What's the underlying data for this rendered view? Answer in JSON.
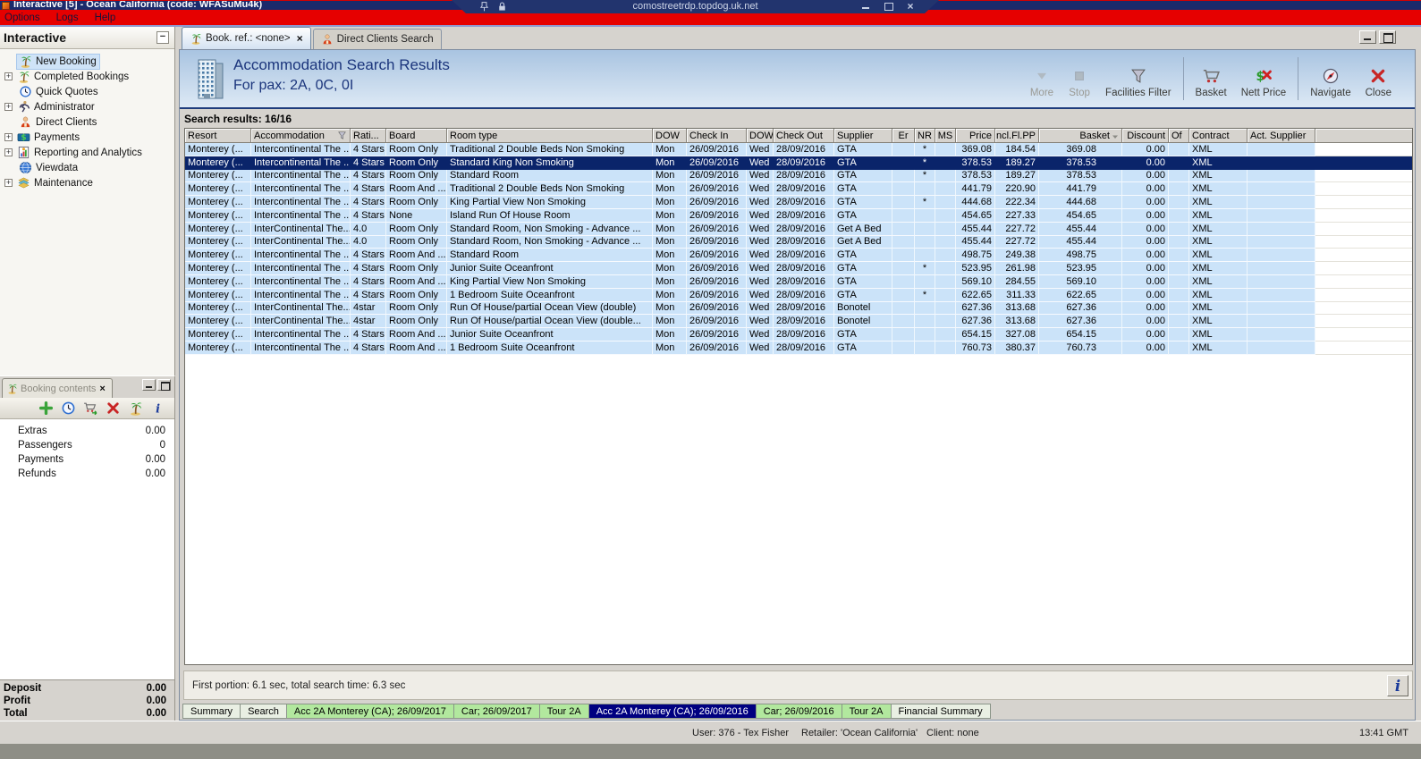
{
  "colors": {
    "accent_navy": "#0a246a",
    "menubar_red": "#e60000",
    "row_blue": "#cbe3f9",
    "tab_green": "#b2e89e",
    "selected_tab_navy": "#000080",
    "header_gradient_top": "#a9c4e1"
  },
  "window": {
    "title": "Interactive [5] - Ocean California (code: WFASuMu4k)",
    "rdp_host": "comostreetrdp.topdog.uk.net"
  },
  "menubar": {
    "items": [
      "Options",
      "Logs",
      "Help"
    ]
  },
  "sidebar": {
    "title": "Interactive",
    "items": [
      {
        "label": "New Booking",
        "icon": "palm-icon",
        "expandable": false,
        "selected": true
      },
      {
        "label": "Completed Bookings",
        "icon": "palm-icon",
        "expandable": true,
        "selected": false
      },
      {
        "label": "Quick Quotes",
        "icon": "clock-icon",
        "expandable": false,
        "selected": false
      },
      {
        "label": "Administrator",
        "icon": "runner-icon",
        "expandable": true,
        "selected": false
      },
      {
        "label": "Direct Clients",
        "icon": "person-icon",
        "expandable": false,
        "selected": false
      },
      {
        "label": "Payments",
        "icon": "payments-icon",
        "expandable": true,
        "selected": false
      },
      {
        "label": "Reporting and Analytics",
        "icon": "report-icon",
        "expandable": true,
        "selected": false
      },
      {
        "label": "Viewdata",
        "icon": "globe-icon",
        "expandable": false,
        "selected": false
      },
      {
        "label": "Maintenance",
        "icon": "maintenance-icon",
        "expandable": true,
        "selected": false
      }
    ]
  },
  "tabs": [
    {
      "label": "Book. ref.: <none>",
      "icon": "palm-icon",
      "active": true,
      "closable": true
    },
    {
      "label": "Direct Clients Search",
      "icon": "person-icon",
      "active": false,
      "closable": false
    }
  ],
  "header": {
    "title": "Accommodation Search Results",
    "subtitle": "For pax: 2A, 0C, 0I"
  },
  "toolbar": {
    "groups": [
      [
        {
          "label": "More",
          "icon": "more-icon",
          "disabled": true
        },
        {
          "label": "Stop",
          "icon": "stop-icon",
          "disabled": true
        },
        {
          "label": "Facilities Filter",
          "icon": "filter-icon",
          "disabled": false
        }
      ],
      [
        {
          "label": "Basket",
          "icon": "basket-icon",
          "disabled": false
        },
        {
          "label": "Nett Price",
          "icon": "nett-price-icon",
          "disabled": false
        }
      ],
      [
        {
          "label": "Navigate",
          "icon": "navigate-icon",
          "disabled": false
        },
        {
          "label": "Close",
          "icon": "close-icon",
          "disabled": false
        }
      ]
    ]
  },
  "results": {
    "summary": "Search results: 16/16",
    "timing": "First portion: 6.1 sec, total search time: 6.3 sec"
  },
  "table": {
    "columns": [
      "Resort",
      "Accommodation",
      "Rati...",
      "Board",
      "Room type",
      "DOW",
      "Check In",
      "DOW",
      "Check Out",
      "Supplier",
      "Er",
      "NR",
      "MS",
      "Price",
      "Incl.Fl.PP",
      "Basket",
      "Discount",
      "Of",
      "Contract",
      "Act. Supplier"
    ],
    "selected_row": 1,
    "rows": [
      [
        "Monterey (...",
        "Intercontinental The ...",
        "4 Stars",
        "Room Only",
        "Traditional 2 Double Beds Non Smoking",
        "Mon",
        "26/09/2016",
        "Wed",
        "28/09/2016",
        "GTA",
        "",
        "*",
        "",
        "369.08",
        "184.54",
        "369.08",
        "0.00",
        "",
        "XML",
        ""
      ],
      [
        "Monterey (...",
        "Intercontinental The ...",
        "4 Stars",
        "Room Only",
        "Standard King Non Smoking",
        "Mon",
        "26/09/2016",
        "Wed",
        "28/09/2016",
        "GTA",
        "",
        "*",
        "",
        "378.53",
        "189.27",
        "378.53",
        "0.00",
        "",
        "XML",
        ""
      ],
      [
        "Monterey (...",
        "Intercontinental The ...",
        "4 Stars",
        "Room Only",
        "Standard Room",
        "Mon",
        "26/09/2016",
        "Wed",
        "28/09/2016",
        "GTA",
        "",
        "*",
        "",
        "378.53",
        "189.27",
        "378.53",
        "0.00",
        "",
        "XML",
        ""
      ],
      [
        "Monterey (...",
        "Intercontinental The ...",
        "4 Stars",
        "Room And ...",
        "Traditional 2 Double Beds Non Smoking",
        "Mon",
        "26/09/2016",
        "Wed",
        "28/09/2016",
        "GTA",
        "",
        "",
        "",
        "441.79",
        "220.90",
        "441.79",
        "0.00",
        "",
        "XML",
        ""
      ],
      [
        "Monterey (...",
        "Intercontinental The ...",
        "4 Stars",
        "Room Only",
        "King Partial View Non Smoking",
        "Mon",
        "26/09/2016",
        "Wed",
        "28/09/2016",
        "GTA",
        "",
        "*",
        "",
        "444.68",
        "222.34",
        "444.68",
        "0.00",
        "",
        "XML",
        ""
      ],
      [
        "Monterey (...",
        "Intercontinental The ...",
        "4 Stars",
        "None",
        "Island Run Of House Room",
        "Mon",
        "26/09/2016",
        "Wed",
        "28/09/2016",
        "GTA",
        "",
        "",
        "",
        "454.65",
        "227.33",
        "454.65",
        "0.00",
        "",
        "XML",
        ""
      ],
      [
        "Monterey (...",
        "InterContinental The...",
        "4.0",
        "Room Only",
        "Standard Room, Non Smoking - Advance ...",
        "Mon",
        "26/09/2016",
        "Wed",
        "28/09/2016",
        "Get A Bed",
        "",
        "",
        "",
        "455.44",
        "227.72",
        "455.44",
        "0.00",
        "",
        "XML",
        ""
      ],
      [
        "Monterey (...",
        "InterContinental The...",
        "4.0",
        "Room Only",
        "Standard Room, Non Smoking - Advance ...",
        "Mon",
        "26/09/2016",
        "Wed",
        "28/09/2016",
        "Get A Bed",
        "",
        "",
        "",
        "455.44",
        "227.72",
        "455.44",
        "0.00",
        "",
        "XML",
        ""
      ],
      [
        "Monterey (...",
        "Intercontinental The ...",
        "4 Stars",
        "Room And ...",
        "Standard Room",
        "Mon",
        "26/09/2016",
        "Wed",
        "28/09/2016",
        "GTA",
        "",
        "",
        "",
        "498.75",
        "249.38",
        "498.75",
        "0.00",
        "",
        "XML",
        ""
      ],
      [
        "Monterey (...",
        "Intercontinental The ...",
        "4 Stars",
        "Room Only",
        "Junior Suite Oceanfront",
        "Mon",
        "26/09/2016",
        "Wed",
        "28/09/2016",
        "GTA",
        "",
        "*",
        "",
        "523.95",
        "261.98",
        "523.95",
        "0.00",
        "",
        "XML",
        ""
      ],
      [
        "Monterey (...",
        "Intercontinental The ...",
        "4 Stars",
        "Room And ...",
        "King Partial View Non Smoking",
        "Mon",
        "26/09/2016",
        "Wed",
        "28/09/2016",
        "GTA",
        "",
        "",
        "",
        "569.10",
        "284.55",
        "569.10",
        "0.00",
        "",
        "XML",
        ""
      ],
      [
        "Monterey (...",
        "Intercontinental The ...",
        "4 Stars",
        "Room Only",
        "1 Bedroom Suite Oceanfront",
        "Mon",
        "26/09/2016",
        "Wed",
        "28/09/2016",
        "GTA",
        "",
        "*",
        "",
        "622.65",
        "311.33",
        "622.65",
        "0.00",
        "",
        "XML",
        ""
      ],
      [
        "Monterey (...",
        "InterContinental The...",
        "4star",
        "Room Only",
        "Run Of House/partial Ocean View (double)",
        "Mon",
        "26/09/2016",
        "Wed",
        "28/09/2016",
        "Bonotel",
        "",
        "",
        "",
        "627.36",
        "313.68",
        "627.36",
        "0.00",
        "",
        "XML",
        ""
      ],
      [
        "Monterey (...",
        "InterContinental The...",
        "4star",
        "Room Only",
        "Run Of House/partial Ocean View (double...",
        "Mon",
        "26/09/2016",
        "Wed",
        "28/09/2016",
        "Bonotel",
        "",
        "",
        "",
        "627.36",
        "313.68",
        "627.36",
        "0.00",
        "",
        "XML",
        ""
      ],
      [
        "Monterey (...",
        "Intercontinental The ...",
        "4 Stars",
        "Room And ...",
        "Junior Suite Oceanfront",
        "Mon",
        "26/09/2016",
        "Wed",
        "28/09/2016",
        "GTA",
        "",
        "",
        "",
        "654.15",
        "327.08",
        "654.15",
        "0.00",
        "",
        "XML",
        ""
      ],
      [
        "Monterey (...",
        "Intercontinental The ...",
        "4 Stars",
        "Room And ...",
        "1 Bedroom Suite Oceanfront",
        "Mon",
        "26/09/2016",
        "Wed",
        "28/09/2016",
        "GTA",
        "",
        "",
        "",
        "760.73",
        "380.37",
        "760.73",
        "0.00",
        "",
        "XML",
        ""
      ]
    ]
  },
  "booking_contents": {
    "title": "Booking contents",
    "buttons": [
      {
        "name": "add-button",
        "icon": "add-icon"
      },
      {
        "name": "quick-quote-button",
        "icon": "clock-icon"
      },
      {
        "name": "move-to-basket-button",
        "icon": "cart-go-icon"
      },
      {
        "name": "delete-button",
        "icon": "delete-icon"
      },
      {
        "name": "booking-button",
        "icon": "palm-icon"
      },
      {
        "name": "info-button",
        "icon": "info-icon"
      }
    ],
    "items": [
      {
        "label": "Extras",
        "value": "0.00"
      },
      {
        "label": "Passengers",
        "value": "0"
      },
      {
        "label": "Payments",
        "value": "0.00"
      },
      {
        "label": "Refunds",
        "value": "0.00"
      }
    ],
    "totals": [
      {
        "label": "Deposit",
        "value": "0.00"
      },
      {
        "label": "Profit",
        "value": "0.00"
      },
      {
        "label": "Total",
        "value": "0.00"
      }
    ]
  },
  "bottom_tabs": [
    {
      "label": "Summary",
      "style": "plain"
    },
    {
      "label": "Search",
      "style": "plain"
    },
    {
      "label": "Acc 2A Monterey (CA); 26/09/2017",
      "style": "green"
    },
    {
      "label": "Car; 26/09/2017",
      "style": "green"
    },
    {
      "label": "Tour 2A",
      "style": "green"
    },
    {
      "label": "Acc 2A Monterey (CA); 26/09/2016",
      "style": "active"
    },
    {
      "label": "Car; 26/09/2016",
      "style": "green"
    },
    {
      "label": "Tour 2A",
      "style": "green"
    },
    {
      "label": "Financial Summary",
      "style": "plain"
    }
  ],
  "statusbar": {
    "user": "User: 376 - Tex Fisher",
    "retailer": "Retailer: 'Ocean California'",
    "client": "Client: none",
    "time": "13:41 GMT"
  }
}
